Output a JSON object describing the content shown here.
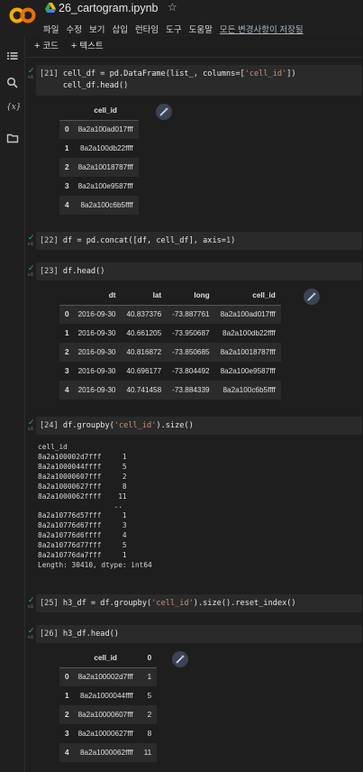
{
  "header": {
    "title": "26_cartogram.ipynb",
    "menu": [
      "파일",
      "수정",
      "보기",
      "삽입",
      "런타임",
      "도구",
      "도움말"
    ],
    "saved_status": "모든 변경사항이 저장됨"
  },
  "toolbar": {
    "code_label": "코드",
    "text_label": "텍스트"
  },
  "cells": [
    {
      "prompt": "[21]",
      "line1_a": "cell_df = pd.DataFrame(list_, columns=[",
      "line1_str": "'cell_id'",
      "line1_b": "])",
      "line2": "cell_df.head()",
      "table": {
        "columns": [
          "cell_id"
        ],
        "rows": [
          [
            "0",
            "8a2a100ad017fff"
          ],
          [
            "1",
            "8a2a100db22ffff"
          ],
          [
            "2",
            "8a2a10018787fff"
          ],
          [
            "3",
            "8a2a100e9587fff"
          ],
          [
            "4",
            "8a2a100c6b5ffff"
          ]
        ]
      }
    },
    {
      "prompt": "[22]",
      "code_a": "df = pd.concat([df, cell_df], axis=",
      "code_num": "1",
      "code_b": ")"
    },
    {
      "prompt": "[23]",
      "code": "df.head()",
      "table": {
        "columns": [
          "dt",
          "lat",
          "long",
          "cell_id"
        ],
        "rows": [
          [
            "0",
            "2016-09-30",
            "40.837376",
            "-73.887761",
            "8a2a100ad017fff"
          ],
          [
            "1",
            "2016-09-30",
            "40.661205",
            "-73.950687",
            "8a2a100db22ffff"
          ],
          [
            "2",
            "2016-09-30",
            "40.816872",
            "-73.850685",
            "8a2a10018787fff"
          ],
          [
            "3",
            "2016-09-30",
            "40.696177",
            "-73.804492",
            "8a2a100e9587fff"
          ],
          [
            "4",
            "2016-09-30",
            "40.741458",
            "-73.884339",
            "8a2a100c6b5ffff"
          ]
        ]
      }
    },
    {
      "prompt": "[24]",
      "code_a": "df.groupby(",
      "code_str": "'cell_id'",
      "code_b": ").size()",
      "output": "cell_id\n8a2a100002d7fff     1\n8a2a1000044ffff     5\n8a2a10000607fff     2\n8a2a10000627fff     8\n8a2a1000062ffff    11\n                  ..\n8a2a10776d57fff     1\n8a2a10776d67fff     3\n8a2a10776d6ffff     4\n8a2a10776d77fff     5\n8a2a10776da7fff     1\nLength: 30410, dtype: int64"
    },
    {
      "prompt": "[25]",
      "code_a": "h3_df = df.groupby(",
      "code_str": "'cell_id'",
      "code_b": ").size().reset_index()"
    },
    {
      "prompt": "[26]",
      "code": "h3_df.head()",
      "table": {
        "columns": [
          "cell_id",
          "0"
        ],
        "rows": [
          [
            "0",
            "8a2a100002d7fff",
            "1"
          ],
          [
            "1",
            "8a2a1000044ffff",
            "5"
          ],
          [
            "2",
            "8a2a10000607fff",
            "2"
          ],
          [
            "3",
            "8a2a10000627fff",
            "8"
          ],
          [
            "4",
            "8a2a1000062ffff",
            "11"
          ]
        ]
      }
    }
  ],
  "icons": [
    "colab-logo",
    "drive-icon",
    "star-icon",
    "toc-icon",
    "search-icon",
    "variables-icon",
    "folder-icon",
    "magic-wand-icon"
  ],
  "colors": {
    "check": "#2fb26b",
    "string": "#ce9178",
    "number": "#b5cea8",
    "logo_orange": "#f9ab00"
  }
}
